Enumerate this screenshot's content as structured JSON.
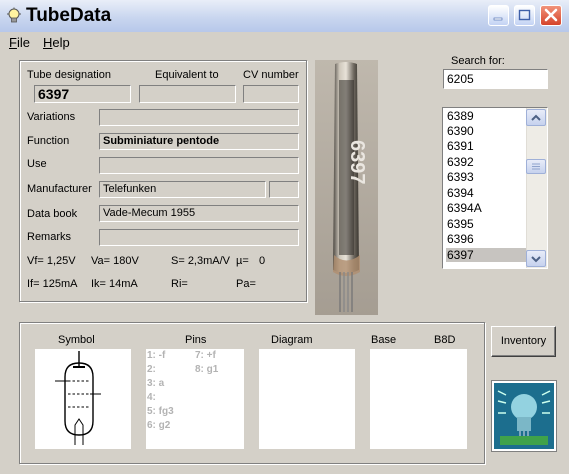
{
  "window": {
    "title": "TubeData"
  },
  "menu": [
    {
      "accel": "F",
      "rest": "ile"
    },
    {
      "accel": "H",
      "rest": "elp"
    }
  ],
  "labels": {
    "designation": "Tube designation",
    "equivalent": "Equivalent to",
    "cv": "CV number",
    "variations": "Variations",
    "function": "Function",
    "use": "Use",
    "manufacturer": "Manufacturer",
    "databook": "Data book",
    "remarks": "Remarks",
    "search": "Search for:",
    "symbol": "Symbol",
    "pins": "Pins",
    "diagram": "Diagram",
    "base": "Base",
    "base_value": "B8D",
    "inventory": "Inventory"
  },
  "tube": {
    "designation": "6397",
    "equivalent": "",
    "cv": "",
    "variations": "",
    "function": "Subminiature pentode",
    "use": "",
    "manufacturer": "Telefunken",
    "manufacturer_extra": "",
    "databook": "Vade-Mecum 1955",
    "remarks": ""
  },
  "params": {
    "vf": "Vf= 1,25V",
    "va": "Va= 180V",
    "s": "S= 2,3mA/V",
    "mu": "µ=",
    "mu_value": "0",
    "if": "If= 125mA",
    "ik": "Ik= 14mA",
    "ri": "Ri=",
    "pa": "Pa="
  },
  "search": {
    "value": "6205"
  },
  "list": {
    "items": [
      "6389",
      "6390",
      "6391",
      "6392",
      "6393",
      "6394",
      "6394A",
      "6395",
      "6396",
      "6397"
    ],
    "selected": "6397"
  },
  "pins": [
    {
      "left": "1: -f",
      "right": "7: +f"
    },
    {
      "left": "2:",
      "right": "8: g1"
    },
    {
      "left": "3: a",
      "right": ""
    },
    {
      "left": "4:",
      "right": ""
    },
    {
      "left": "5: fg3",
      "right": ""
    },
    {
      "left": "6: g2",
      "right": ""
    }
  ],
  "photo_marking": "6397",
  "colors": {
    "title_bar": "#c9d6ef",
    "close_button": "#d5432a",
    "face": "#d4d0c8",
    "logo_bg": "#1c6e8e"
  }
}
